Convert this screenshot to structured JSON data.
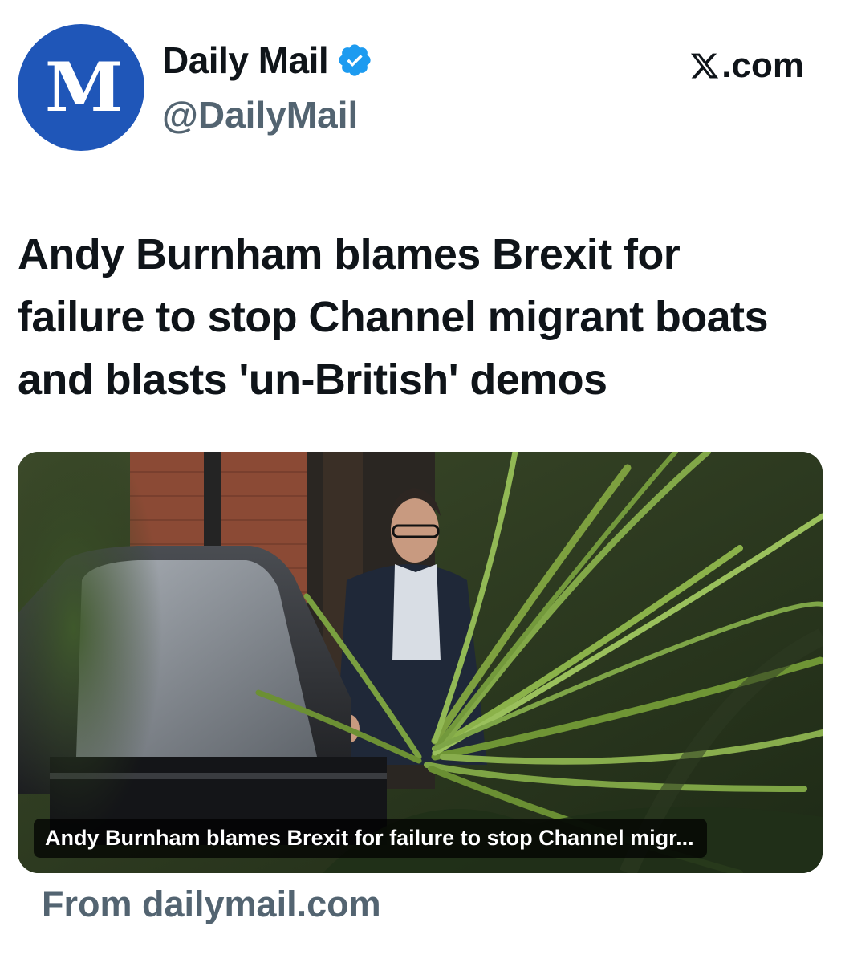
{
  "account": {
    "display_name": "Daily Mail",
    "handle": "@DailyMail",
    "avatar_letter": "M",
    "avatar_color": "#1f56b8",
    "verified_icon": "verified-badge-icon",
    "verified_color": "#1d9bf0"
  },
  "source": {
    "label": ".com",
    "icon": "x-logo-icon"
  },
  "post": {
    "headline": "Andy Burnham blames Brexit for failure to stop Channel migrant boats and blasts 'un-British' demos"
  },
  "link_card": {
    "image_subject": "photo",
    "caption": "Andy Burnham blames Brexit for failure to stop Channel migr...",
    "domain_text": "From dailymail.com"
  },
  "colors": {
    "text_primary": "#0f1419",
    "text_secondary": "#536471",
    "background": "#ffffff"
  }
}
